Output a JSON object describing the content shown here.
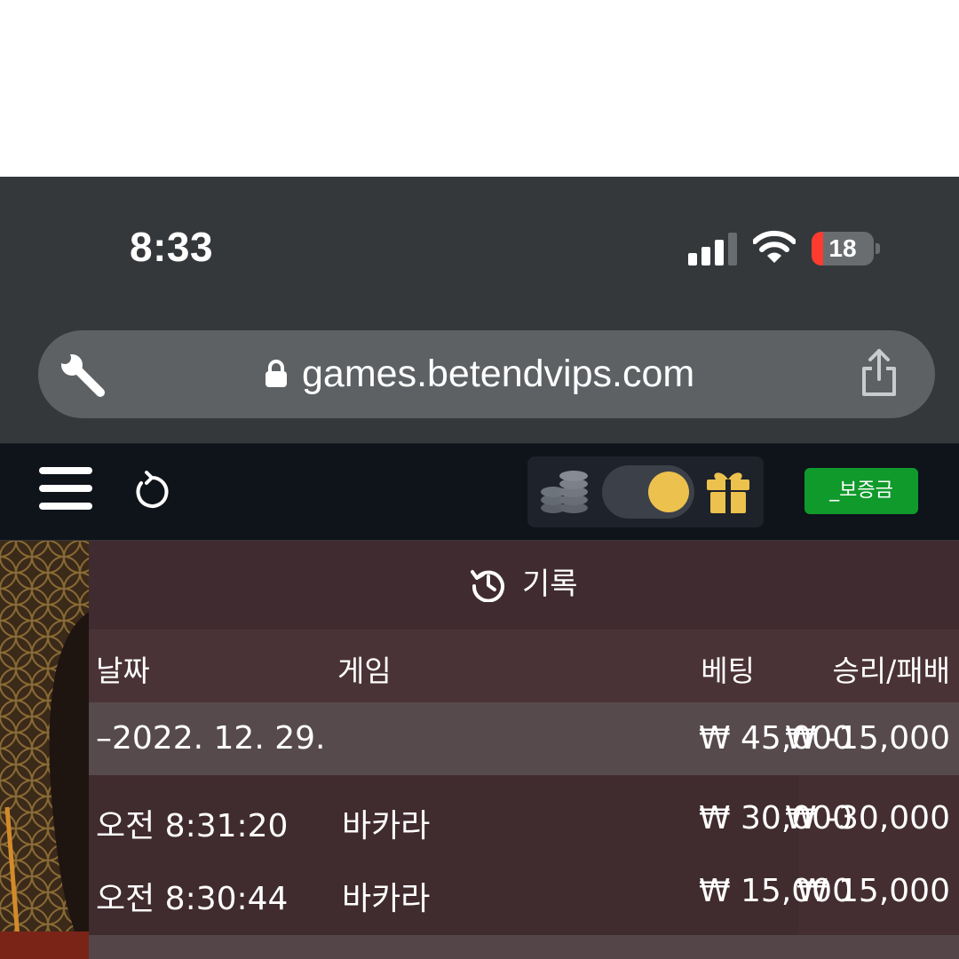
{
  "status_bar": {
    "time": "8:33",
    "battery_level": "18"
  },
  "browser": {
    "url": "games.betendvips.com"
  },
  "site_header": {
    "deposit_label": "_보증금"
  },
  "history": {
    "title": "기록",
    "columns": {
      "date": "날짜",
      "game": "게임",
      "bet": "베팅",
      "win_loss": "승리/패배"
    },
    "groups": [
      {
        "date": "–2022. 12. 29.",
        "bet_total": "₩ 45,000",
        "win_loss_total": "₩ -15,000",
        "rows": [
          {
            "time": "오전 8:31:20",
            "game": "바카라",
            "bet": "₩ 30,000",
            "win_loss": "₩ -30,000"
          },
          {
            "time": "오전 8:30:44",
            "game": "바카라",
            "bet": "₩ 15,000",
            "win_loss": "₩ 15,000"
          }
        ]
      }
    ]
  },
  "colors": {
    "battery_low": "#ff3b30",
    "toggle_knob": "#ecc14d",
    "deposit_button": "#0f9a2b",
    "gift": "#ecc14d"
  }
}
